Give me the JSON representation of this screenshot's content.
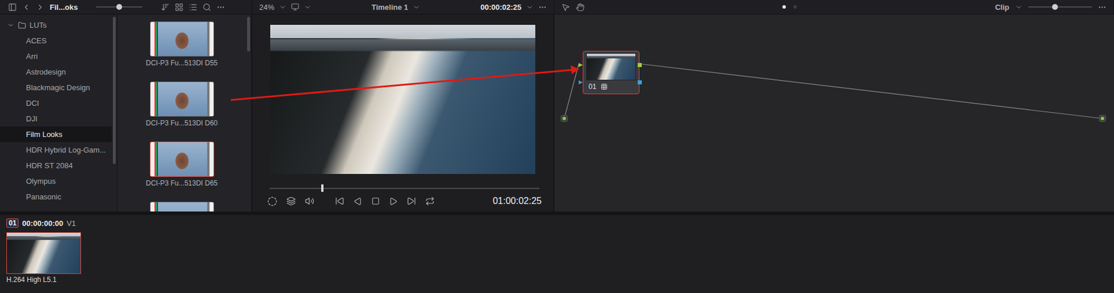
{
  "top_bar": {
    "panel_title": "Fil...oks",
    "thumb_size_level": 0.5,
    "zoom": "24%",
    "timeline": "Timeline 1",
    "timecode": "00:00:02:25",
    "node_mode": "Clip",
    "node_zoom_level": 0.42,
    "pages": [
      {
        "selected": true
      },
      {
        "selected": false
      }
    ]
  },
  "lut_tree": {
    "root": {
      "label": "LUTs",
      "expanded": true
    },
    "items": [
      {
        "label": "ACES",
        "selected": false
      },
      {
        "label": "Arri",
        "selected": false
      },
      {
        "label": "Astrodesign",
        "selected": false
      },
      {
        "label": "Blackmagic Design",
        "selected": false
      },
      {
        "label": "DCI",
        "selected": false
      },
      {
        "label": "DJI",
        "selected": false
      },
      {
        "label": "Film Looks",
        "selected": true
      },
      {
        "label": "HDR Hybrid Log-Gam...",
        "selected": false
      },
      {
        "label": "HDR ST 2084",
        "selected": false
      },
      {
        "label": "Olympus",
        "selected": false
      },
      {
        "label": "Panasonic",
        "selected": false
      }
    ]
  },
  "lut_browser": {
    "thumbnails": [
      {
        "kind": "full",
        "label": "DCI-P3 Fu...513DI D55",
        "selected": false
      },
      {
        "kind": "full",
        "label": "DCI-P3 Fu...513DI D60",
        "selected": false
      },
      {
        "kind": "full",
        "label": "DCI-P3 Fu...513DI D65",
        "selected": true
      },
      {
        "kind": "partial",
        "selected": false
      }
    ]
  },
  "viewer": {
    "playhead_level": 0.195,
    "timecode": "01:00:02:25"
  },
  "node_graph": {
    "nodes": [
      {
        "label": "01",
        "selected": true
      }
    ]
  },
  "timeline": {
    "clip_number": "01",
    "timecode": "00:00:00:00",
    "track": "V1",
    "clips": [
      {
        "label": "H.264 High L5.1",
        "selected": true
      }
    ]
  }
}
